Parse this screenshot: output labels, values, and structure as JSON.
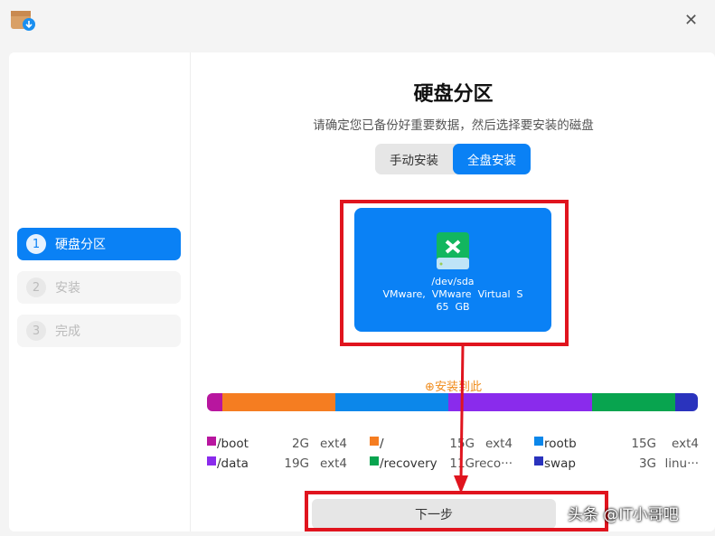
{
  "window": {
    "close_icon": "close-icon"
  },
  "sidebar": {
    "steps": [
      {
        "num": "1",
        "label": "硬盘分区"
      },
      {
        "num": "2",
        "label": "安装"
      },
      {
        "num": "3",
        "label": "完成"
      }
    ]
  },
  "main": {
    "title": "硬盘分区",
    "subtitle": "请确定您已备份好重要数据，然后选择要安装的磁盘",
    "tabs": [
      "手动安装",
      "全盘安装"
    ],
    "disk": {
      "device": "/dev/sda",
      "model": "VMware,  VMware  Virtual  S",
      "size": "65  GB"
    },
    "install_hint": "安装到此",
    "partitions": [
      {
        "name": "/boot",
        "size": "2G",
        "fs": "ext4",
        "color": "#b8169f",
        "gb": 2
      },
      {
        "name": "/",
        "size": "15G",
        "fs": "ext4",
        "color": "#f57d21",
        "gb": 15
      },
      {
        "name": "rootb",
        "size": "15G",
        "fs": "ext4",
        "color": "#0c87ea",
        "gb": 15
      },
      {
        "name": "/data",
        "size": "19G",
        "fs": "ext4",
        "color": "#8a2bec",
        "gb": 19
      },
      {
        "name": "/recovery",
        "size": "11G",
        "fs": "reco···",
        "color": "#08a44f",
        "gb": 11
      },
      {
        "name": "swap",
        "size": "3G",
        "fs": "linu···",
        "color": "#2a33bd",
        "gb": 3
      }
    ],
    "next_button": "下一步"
  },
  "watermark": "头条 @IT小哥吧"
}
